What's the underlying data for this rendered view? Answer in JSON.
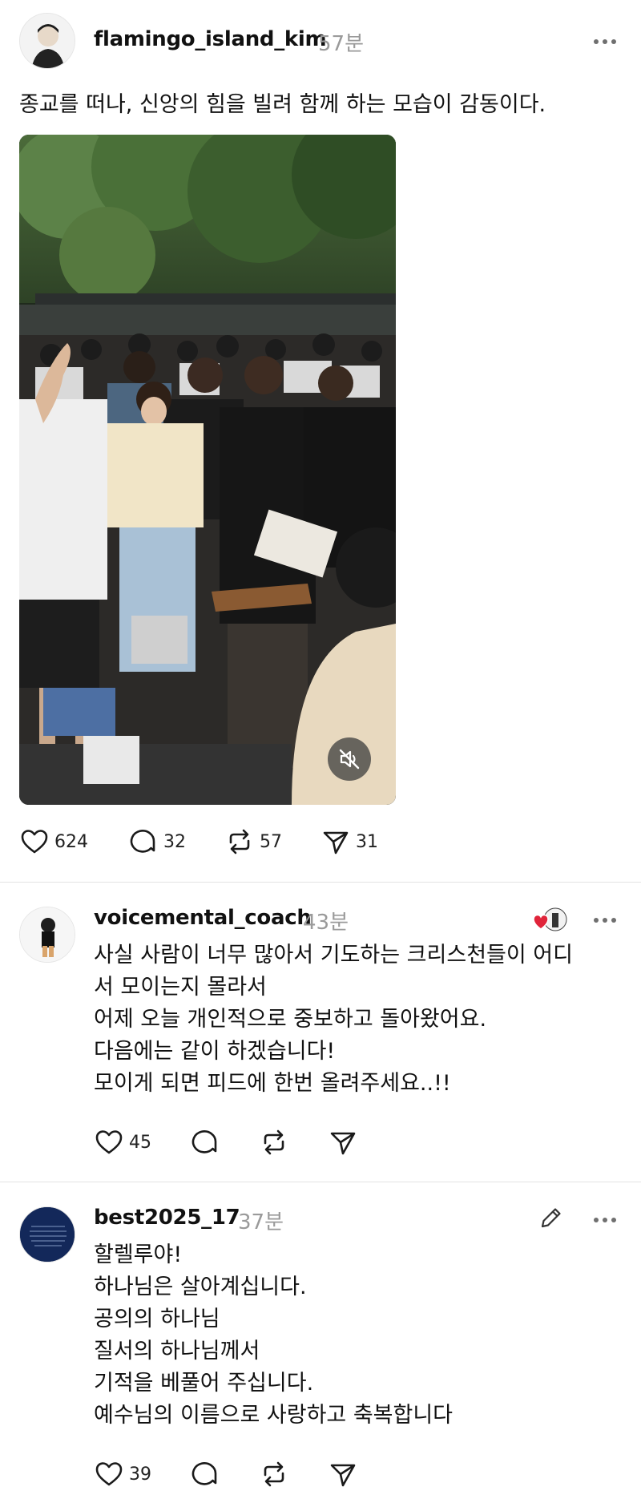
{
  "posts": [
    {
      "username": "flamingo_island_kim",
      "time": "57분",
      "text": [
        "종교를 떠나, 신앙의 힘을 빌려 함께 하는 모습이 감동이다."
      ],
      "likes": "624",
      "replies": "32",
      "reposts": "57",
      "shares": "31"
    },
    {
      "username": "voicemental_coach",
      "time": "43분",
      "text": [
        "사실 사람이 너무 많아서 기도하는 크리스천들이 어디",
        "서 모이는지 몰라서",
        "어제 오늘 개인적으로 중보하고 돌아왔어요.",
        "다음에는 같이 하겠습니다!",
        "모이게 되면 피드에 한번 올려주세요..!!"
      ],
      "likes": "45"
    },
    {
      "username": "best2025_17",
      "time": "37분",
      "text": [
        "할렐루야!",
        "하나님은 살아계십니다.",
        "공의의 하나님",
        "질서의 하나님께서",
        "기적을 베풀어 주십니다.",
        "예수님의 이름으로 사랑하고 축복합니다"
      ],
      "likes": "39"
    }
  ],
  "icons": {
    "like": "heart-icon",
    "reply": "comment-icon",
    "repost": "repost-icon",
    "share": "send-icon",
    "more": "more-dots-icon",
    "mute": "speaker-muted-icon",
    "edit": "pencil-icon",
    "liked_by_author": "heart-badge-icon"
  },
  "colors": {
    "heart_badge": "#e0243a",
    "secondary_text": "#9a9a9a",
    "divider": "#e3e3e3"
  }
}
